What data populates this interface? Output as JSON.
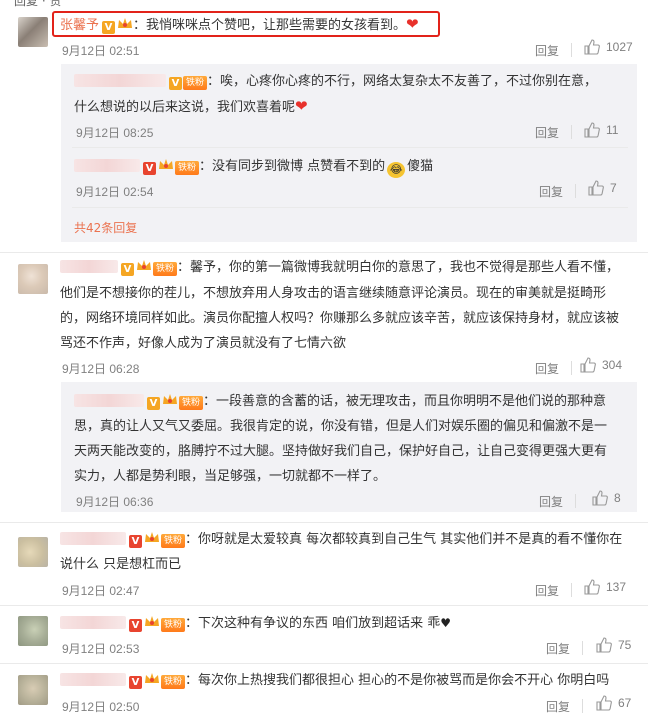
{
  "top_fragment": "回复 · 赞",
  "comments": [
    {
      "name": "张馨予",
      "text": "：我悄咪咪点个赞吧，让那些需要的女孩看到。",
      "time": "9月12日 02:51",
      "reply_label": "回复",
      "likes": "1027",
      "replies": [
        {
          "line1": "：唉，心疼你心疼的不行，网络太复杂太不友善了，不过你别在意，",
          "line2": "什么想说的以后来这说，我们欢喜着呢",
          "time": "9月12日 08:25",
          "reply_label": "回复",
          "likes": "11"
        },
        {
          "line1": "：没有同步到微博 点赞看不到的",
          "line1_end": "傻猫",
          "time": "9月12日 02:54",
          "reply_label": "回复",
          "likes": "7"
        }
      ],
      "more_replies": "共42条回复"
    },
    {
      "lines": [
        "：馨予，你的第一篇微博我就明白你的意思了，我也不觉得是那些人看不懂，",
        "他们是不想接你的茬儿，不想放弃用人身攻击的语言继续随意评论演员。现在的审美就是挺畸形",
        "的，网络环境同样如此。演员你配擅人权吗？你赚那么多就应该辛苦，就应该保持身材，就应该被",
        "骂还不作声，好像人成为了演员就没有了七情六欲"
      ],
      "time": "9月12日 06:28",
      "reply_label": "回复",
      "likes": "304",
      "reply": {
        "lines": [
          "：一段善意的含蓄的话，被无理攻击，而且你明明不是他们说的那种意",
          "思，真的让人又气又委屈。我很肯定的说，你没有错，但是人们对娱乐圈的偏见和偏激不是一",
          "天两天能改变的，胳膊拧不过大腿。坚持做好我们自己，保护好自己，让自己变得更强大更有",
          "实力，人都是势利眼，当足够强，一切就都不一样了。"
        ],
        "time": "9月12日 06:36",
        "reply_label": "回复",
        "likes": "8"
      }
    },
    {
      "lines": [
        "：你呀就是太爱较真 每次都较真到自己生气 其实他们并不是真的看不懂你在",
        "说什么 只是想杠而已"
      ],
      "time": "9月12日 02:47",
      "reply_label": "回复",
      "likes": "137"
    },
    {
      "lines": [
        "：下次这种有争议的东西 咱们放到超话来 乖"
      ],
      "time": "9月12日 02:53",
      "reply_label": "回复",
      "likes": "75"
    },
    {
      "lines": [
        "：每次你上热搜我们都很担心 担心的不是你被骂而是你会不开心 你明白吗"
      ],
      "time": "9月12日 02:50",
      "reply_label": "回复",
      "likes": "67"
    }
  ],
  "badges": {
    "vip": "V",
    "fan": "铁粉"
  },
  "colors": {
    "accent": "#eb7350",
    "highlight": "#e2231a",
    "meta": "#808080",
    "subbox": "#f2f2f5"
  },
  "icons": [
    "thumbs-up-icon",
    "vip-badge-icon",
    "crown-icon",
    "heart-icon",
    "laughing-emoji-icon",
    "black-heart-icon"
  ]
}
